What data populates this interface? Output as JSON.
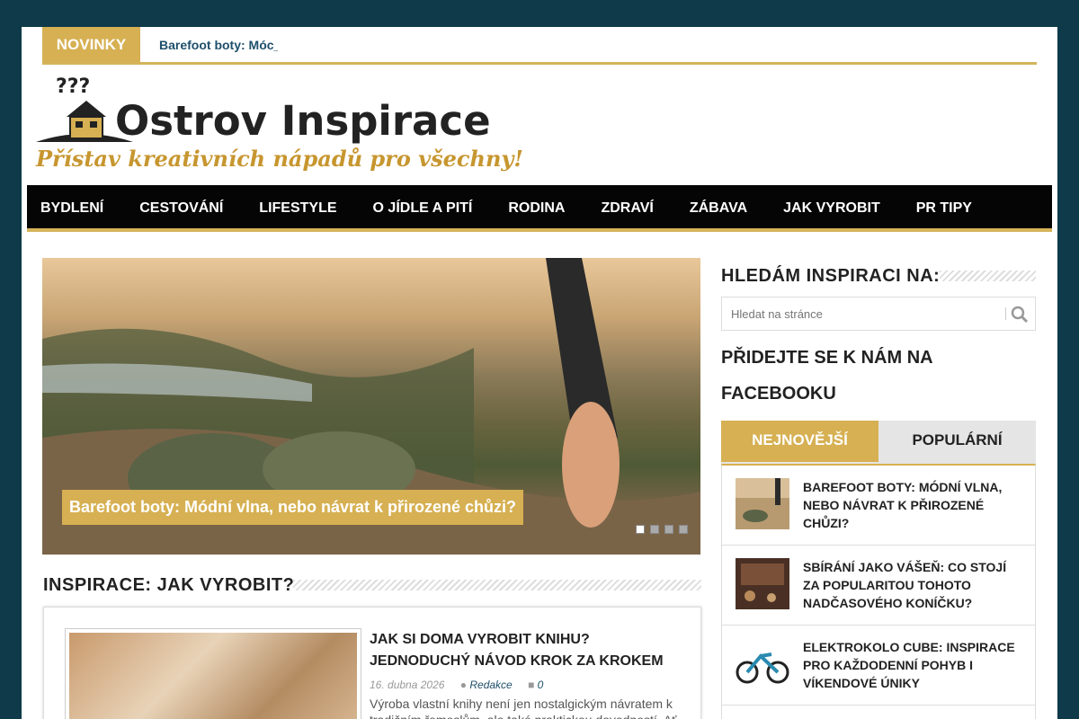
{
  "ticker": {
    "label": "NOVINKY",
    "text": "Barefoot boty: Móc_"
  },
  "logo": {
    "title": "Ostrov Inspirace",
    "tagline": "Přístav kreativních nápadů pro všechny!"
  },
  "nav": {
    "items": [
      {
        "label": "BYDLENÍ"
      },
      {
        "label": "CESTOVÁNÍ"
      },
      {
        "label": "LIFESTYLE"
      },
      {
        "label": "O JÍDLE A PITÍ"
      },
      {
        "label": "RODINA"
      },
      {
        "label": "ZDRAVÍ"
      },
      {
        "label": "ZÁBAVA"
      },
      {
        "label": "JAK VYROBIT"
      },
      {
        "label": "PR TIPY"
      }
    ]
  },
  "slider": {
    "caption": "Barefoot boty: Módní vlna, nebo návrat k přirozené chůzi?",
    "dots": 4,
    "active_dot": 1
  },
  "main": {
    "section_title": "INSPIRACE: JAK VYROBIT?",
    "article": {
      "title": "JAK SI DOMA VYROBIT KNIHU? JEDNODUCHÝ NÁVOD KROK ZA KROKEM",
      "date": "16. dubna 2026",
      "author": "Redakce",
      "comments": "0",
      "excerpt": "Výroba vlastní knihy není jen nostalgickým návratem k tradičním řemeslům, ale také praktickou dovedností. Ať"
    }
  },
  "sidebar": {
    "search_heading": "HLEDÁM INSPIRACI NA:",
    "search_placeholder": "Hledat na stránce",
    "facebook_heading": "PŘIDEJTE SE K NÁM NA FACEBOOKU",
    "tabs": [
      {
        "label": "NEJNOVĚJŠÍ"
      },
      {
        "label": "POPULÁRNÍ"
      }
    ],
    "entries": [
      {
        "title": "BAREFOOT BOTY: MÓDNÍ VLNA, NEBO NÁVRAT K PŘIROZENÉ CHŮZI?"
      },
      {
        "title": "SBÍRÁNÍ JAKO VÁŠEŇ: CO STOJÍ ZA POPULARITOU TOHOTO NADČASOVÉHO KONÍČKU?"
      },
      {
        "title": "ELEKTROKOLO CUBE: INSPIRACE PRO KAŽDODENNÍ POHYB I VÍKENDOVÉ ÚNIKY"
      }
    ]
  },
  "colors": {
    "accent": "#d6b052",
    "background": "#0e3a4a",
    "nav_bg": "#050505",
    "link": "#1f4f6b"
  }
}
